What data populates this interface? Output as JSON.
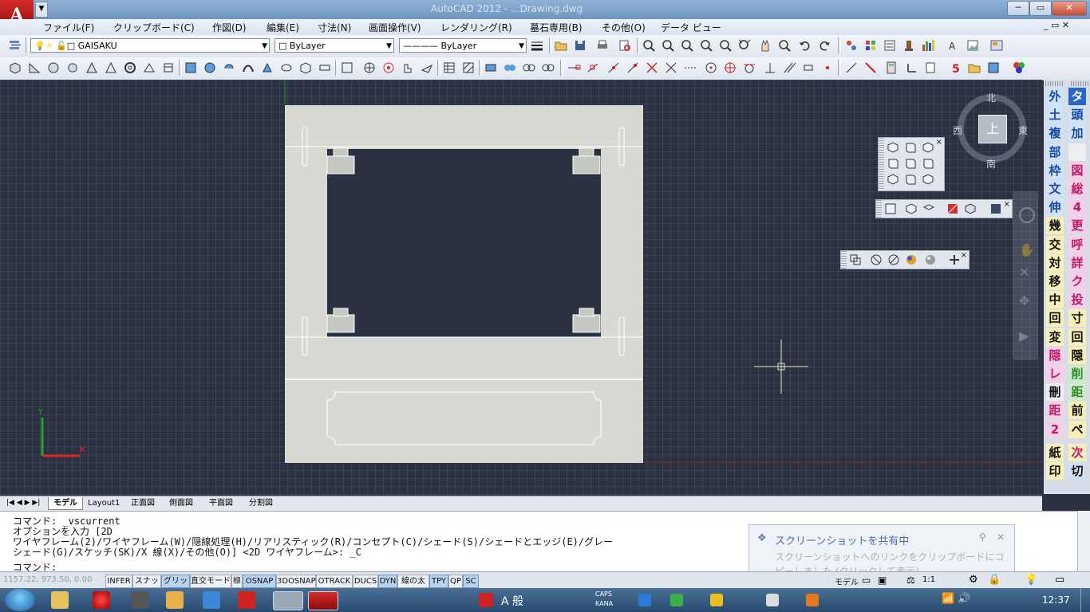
{
  "window": {
    "title": "AutoCAD 2012 - ...Drawing.dwg",
    "min_label": "─",
    "max_label": "▭",
    "close_label": "✕"
  },
  "app_button": "A",
  "menu": [
    "ファイル(F)",
    "クリップボード(C)",
    "作図(D)",
    "編集(E)",
    "寸法(N)",
    "画面操作(V)",
    "レンダリング(R)",
    "墓石専用(B)",
    "その他(O)",
    "データ ビュー"
  ],
  "layer_combo": {
    "value": "GAISAKU"
  },
  "color_combo": {
    "value": "ByLayer"
  },
  "linetype_combo": {
    "value": "ByLayer"
  },
  "viewcube": {
    "north": "北",
    "south": "南",
    "east": "東",
    "west": "西",
    "face": "上"
  },
  "right_palette_col1": [
    "外",
    "土",
    "複",
    "部",
    "枠",
    "文",
    "伸",
    "幾",
    "交",
    "対",
    "移",
    "中",
    "回",
    "変",
    "隠",
    "レ",
    "刪",
    "距",
    "2",
    "紙",
    "印"
  ],
  "right_palette_col2": [
    "タ",
    "頭",
    "加",
    "",
    "図",
    "総",
    "4",
    "更",
    "呼",
    "詳",
    "ク",
    "投",
    "寸",
    "回",
    "隠",
    "削",
    "距",
    "前",
    "ペ",
    "次",
    "切"
  ],
  "layout_tabs": [
    "モデル",
    "Layout1",
    "正面図",
    "側面図",
    "平面図",
    "分割図"
  ],
  "command_lines": [
    "コマンド: _vscurrent",
    "オプションを入力 [2D",
    "ワイヤフレーム(2)/ワイヤフレーム(W)/隠線処理(H)/リアリスティック(R)/コンセプト(C)/シェード(S)/シェードとエッジ(E)/グレー",
    "シェード(G)/スケッチ(SK)/X 線(X)/その他(O)] <2D ワイヤフレーム>: _C",
    "コマンド:"
  ],
  "coords": "1157.22, 973.50, 0.00",
  "status_buttons": [
    {
      "label": "INFER",
      "on": false
    },
    {
      "label": "スナップ",
      "on": false
    },
    {
      "label": "グリッド",
      "on": true
    },
    {
      "label": "直交モード",
      "on": false
    },
    {
      "label": "極",
      "on": false
    },
    {
      "label": "OSNAP",
      "on": true
    },
    {
      "label": "3DOSNAP",
      "on": false
    },
    {
      "label": "OTRACK",
      "on": false
    },
    {
      "label": "DUCS",
      "on": false
    },
    {
      "label": "DYN",
      "on": true
    },
    {
      "label": "線の太さ",
      "on": false
    },
    {
      "label": "TPY",
      "on": true
    },
    {
      "label": "QP",
      "on": false
    },
    {
      "label": "SC",
      "on": true
    }
  ],
  "model_label": "モデル",
  "scale_label": "1:1",
  "notification": {
    "title": "スクリーンショットを共有中",
    "body1": "スクリーンショットへのリンクをクリップボードにコ",
    "body2": "ピーしました (クリックして表示)"
  },
  "taskbar": {
    "ime": "A 般",
    "caps": "CAPS",
    "kana": "KANA",
    "clock": "12:37"
  },
  "colors": {
    "drawing_bg": "#2b3140",
    "sheet": "#d8d9d2",
    "accent_red": "#c0141c"
  }
}
